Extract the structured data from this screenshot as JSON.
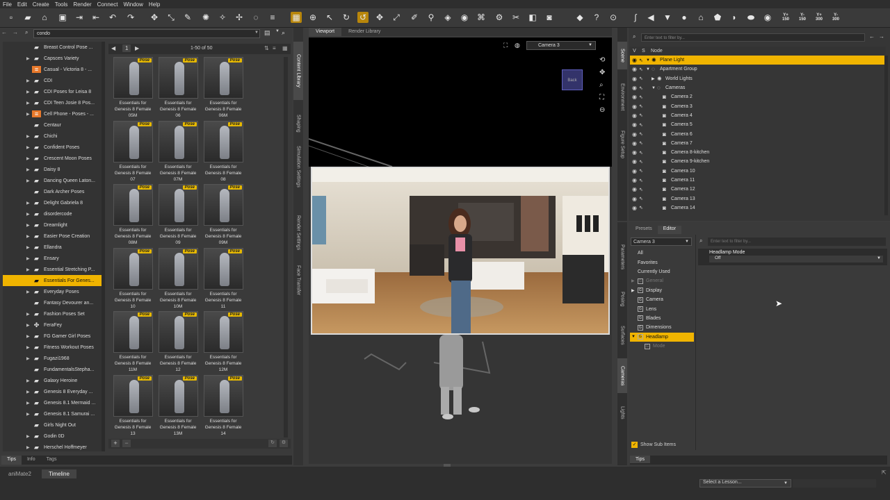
{
  "menu": [
    "File",
    "Edit",
    "Create",
    "Tools",
    "Render",
    "Connect",
    "Window",
    "Help"
  ],
  "toolbar_right": [
    "Y+\n150",
    "Y-\n150",
    "Y+\n300",
    "Y-\n300"
  ],
  "content_library": {
    "search": "condo",
    "page_info": "1-50 of 50",
    "page_num": "1",
    "tree": [
      {
        "label": "Breast Control Pose ...",
        "arrow": ""
      },
      {
        "label": "Capsces Variety",
        "arrow": "▶"
      },
      {
        "label": "Casual - Victoria 8 - ...",
        "arrow": "",
        "icon": "product"
      },
      {
        "label": "CDI",
        "arrow": "▶"
      },
      {
        "label": "CDI Poses for Leisa 8",
        "arrow": "▶"
      },
      {
        "label": "CDI Teen Josie 8 Pos...",
        "arrow": "▶"
      },
      {
        "label": "Cell Phone - Poses - ...",
        "arrow": "▶",
        "icon": "product"
      },
      {
        "label": "Centaur",
        "arrow": ""
      },
      {
        "label": "Chichi",
        "arrow": "▶"
      },
      {
        "label": "Confident Poses",
        "arrow": "▶"
      },
      {
        "label": "Crescent Moon Poses",
        "arrow": "▶"
      },
      {
        "label": "Daisy 8",
        "arrow": "▶"
      },
      {
        "label": "Dancing Queen Laton...",
        "arrow": "▶"
      },
      {
        "label": "Dark Archer Poses",
        "arrow": ""
      },
      {
        "label": "Delight Gabriela 8",
        "arrow": "▶"
      },
      {
        "label": "disordercode",
        "arrow": "▶"
      },
      {
        "label": "Dreamlight",
        "arrow": "▶"
      },
      {
        "label": "Easier Pose Creation",
        "arrow": "▶"
      },
      {
        "label": "Ellandra",
        "arrow": "▶"
      },
      {
        "label": "Ensary",
        "arrow": "▶"
      },
      {
        "label": "Essential Stretching P...",
        "arrow": "▶"
      },
      {
        "label": "Essentials For Genes...",
        "arrow": "",
        "selected": true
      },
      {
        "label": "Everyday Poses",
        "arrow": "▶"
      },
      {
        "label": "Fantasy Devourer an...",
        "arrow": ""
      },
      {
        "label": "Fashion Poses Set",
        "arrow": "▶"
      },
      {
        "label": "FeraFey",
        "arrow": "▶",
        "icon": "gear"
      },
      {
        "label": "FG Gamer Girl Poses",
        "arrow": "▶"
      },
      {
        "label": "Fitness Workout Poses",
        "arrow": "▶"
      },
      {
        "label": "Fugazi1968",
        "arrow": "▶"
      },
      {
        "label": "FundamentalsStepha...",
        "arrow": ""
      },
      {
        "label": "Galaxy Heroine",
        "arrow": "▶"
      },
      {
        "label": "Genesis 8 Everyday ...",
        "arrow": "▶"
      },
      {
        "label": "Genesis 8.1 Mermaid ...",
        "arrow": "▶"
      },
      {
        "label": "Genesis 8.1 Samurai ...",
        "arrow": "▶"
      },
      {
        "label": "Girls Night Out",
        "arrow": ""
      },
      {
        "label": "Godin 0D",
        "arrow": "▶"
      },
      {
        "label": "Herschel Hoffmeyer",
        "arrow": "▶"
      }
    ],
    "items": [
      {
        "l1": "Essentials for",
        "l2": "Genesis 8 Female",
        "l3": "05M"
      },
      {
        "l1": "Essentials for",
        "l2": "Genesis 8 Female",
        "l3": "06"
      },
      {
        "l1": "Essentials for",
        "l2": "Genesis 8 Female",
        "l3": "06M"
      },
      {
        "l1": "Essentials for",
        "l2": "Genesis 8 Female",
        "l3": "07"
      },
      {
        "l1": "Essentials for",
        "l2": "Genesis 8 Female",
        "l3": "07M"
      },
      {
        "l1": "Essentials for",
        "l2": "Genesis 8 Female",
        "l3": "08"
      },
      {
        "l1": "Essentials for",
        "l2": "Genesis 8 Female",
        "l3": "08M"
      },
      {
        "l1": "Essentials for",
        "l2": "Genesis 8 Female",
        "l3": "09"
      },
      {
        "l1": "Essentials for",
        "l2": "Genesis 8 Female",
        "l3": "09M"
      },
      {
        "l1": "Essentials for",
        "l2": "Genesis 8 Female",
        "l3": "10"
      },
      {
        "l1": "Essentials for",
        "l2": "Genesis 8 Female",
        "l3": "10M"
      },
      {
        "l1": "Essentials for",
        "l2": "Genesis 8 Female",
        "l3": "11"
      },
      {
        "l1": "Essentials for",
        "l2": "Genesis 8 Female",
        "l3": "11M"
      },
      {
        "l1": "Essentials for",
        "l2": "Genesis 8 Female",
        "l3": "12"
      },
      {
        "l1": "Essentials for",
        "l2": "Genesis 8 Female",
        "l3": "12M"
      },
      {
        "l1": "Essentials for",
        "l2": "Genesis 8 Female",
        "l3": "13"
      },
      {
        "l1": "Essentials for",
        "l2": "Genesis 8 Female",
        "l3": "13M"
      },
      {
        "l1": "Essentials for",
        "l2": "Genesis 8 Female",
        "l3": "14"
      }
    ],
    "badge": "Pose",
    "bottom_tabs": [
      "Tips",
      "Info",
      "Tags"
    ]
  },
  "left_vtabs": [
    "Content Library",
    "Shaping",
    "Simulation Settings",
    "Render Settings",
    "Face Transfer"
  ],
  "viewport": {
    "tabs": [
      "Viewport",
      "Render Library"
    ],
    "camera": "Camera 3",
    "cube_label": "Back"
  },
  "scene": {
    "filter_placeholder": "Enter text to filter by...",
    "col_v": "V",
    "col_s": "S",
    "col_node": "Node",
    "rows": [
      {
        "label": "Plane Light",
        "indent": 0,
        "arrow": "▼",
        "selected": true,
        "icon": "light"
      },
      {
        "label": "Apartment Group",
        "indent": 0,
        "arrow": "▼",
        "icon": "group"
      },
      {
        "label": "World Lights",
        "indent": 1,
        "arrow": "▶",
        "icon": "light"
      },
      {
        "label": "Cameras",
        "indent": 1,
        "arrow": "▼",
        "icon": "group"
      },
      {
        "label": "Camera 2",
        "indent": 2,
        "arrow": "",
        "icon": "camera"
      },
      {
        "label": "Camera 3",
        "indent": 2,
        "arrow": "",
        "icon": "camera"
      },
      {
        "label": "Camera 4",
        "indent": 2,
        "arrow": "",
        "icon": "camera"
      },
      {
        "label": "Camera 5",
        "indent": 2,
        "arrow": "",
        "icon": "camera"
      },
      {
        "label": "Camera 6",
        "indent": 2,
        "arrow": "",
        "icon": "camera"
      },
      {
        "label": "Camera 7",
        "indent": 2,
        "arrow": "",
        "icon": "camera"
      },
      {
        "label": "Camera 8-kitchen",
        "indent": 2,
        "arrow": "",
        "icon": "camera"
      },
      {
        "label": "Camera 9-kitchen",
        "indent": 2,
        "arrow": "",
        "icon": "camera"
      },
      {
        "label": "Camera 10",
        "indent": 2,
        "arrow": "",
        "icon": "camera"
      },
      {
        "label": "Camera 11",
        "indent": 2,
        "arrow": "",
        "icon": "camera"
      },
      {
        "label": "Camera 12",
        "indent": 2,
        "arrow": "",
        "icon": "camera"
      },
      {
        "label": "Camera 13",
        "indent": 2,
        "arrow": "",
        "icon": "camera"
      },
      {
        "label": "Camera 14",
        "indent": 2,
        "arrow": "",
        "icon": "camera"
      }
    ]
  },
  "right_vtabs_top": [
    "Scene",
    "Environment",
    "Figure Setup"
  ],
  "right_vtabs_bottom": [
    "Parameters",
    "Posing",
    "Surfaces",
    "Cameras",
    "Lights"
  ],
  "params": {
    "tabs": [
      "Presets",
      "Editor"
    ],
    "node": "Camera 3",
    "filter_placeholder": "Enter text to filter by...",
    "list": [
      {
        "label": "All",
        "arrow": "",
        "box": false
      },
      {
        "label": "Favorites",
        "arrow": "",
        "box": false
      },
      {
        "label": "Currently Used",
        "arrow": "",
        "box": false
      },
      {
        "label": "General",
        "arrow": "▶",
        "box": true,
        "dim": true
      },
      {
        "label": "Display",
        "arrow": "▶",
        "box": true
      },
      {
        "label": "Camera",
        "arrow": "",
        "box": true
      },
      {
        "label": "Lens",
        "arrow": "",
        "box": true
      },
      {
        "label": "Blades",
        "arrow": "",
        "box": true
      },
      {
        "label": "Dimensions",
        "arrow": "",
        "box": true
      },
      {
        "label": "Headlamp",
        "arrow": "▼",
        "box": true,
        "selected": true
      },
      {
        "label": "Mode",
        "arrow": "",
        "box": true,
        "dim": true,
        "indent": true
      }
    ],
    "prop_label": "Headlamp Mode",
    "prop_value": "Off",
    "show_sub": "Show Sub Items",
    "tips": "Tips"
  },
  "bottom": {
    "tabs": [
      "aniMate2",
      "Timeline"
    ],
    "lesson": "Select a Lesson..."
  }
}
